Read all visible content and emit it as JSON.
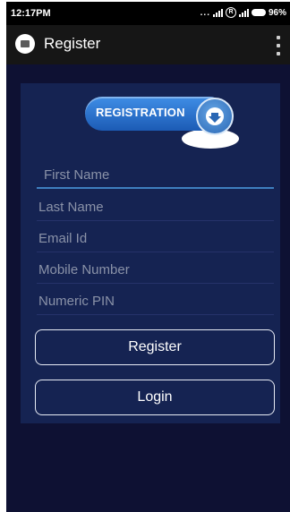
{
  "statusbar": {
    "time": "12:17PM",
    "dots": "...",
    "roaming": "R",
    "battery": "96%",
    "icons": [
      "signal-icon",
      "roaming-icon",
      "signal-icon",
      "battery-icon"
    ]
  },
  "appbar": {
    "title": "Register",
    "logo_icon": "app-logo-icon",
    "menu_icon": "overflow-menu-icon"
  },
  "banner": {
    "label": "REGISTRATION",
    "icon": "download-arrow-icon"
  },
  "form": {
    "first_name_placeholder": "First Name",
    "last_name_placeholder": "Last Name",
    "email_placeholder": "Email Id",
    "mobile_placeholder": "Mobile Number",
    "pin_placeholder": "Numeric PIN"
  },
  "buttons": {
    "register_label": "Register",
    "login_label": "Login"
  },
  "colors": {
    "background": "#0e1133",
    "card": "#152352",
    "accent": "#3f7fbf"
  }
}
